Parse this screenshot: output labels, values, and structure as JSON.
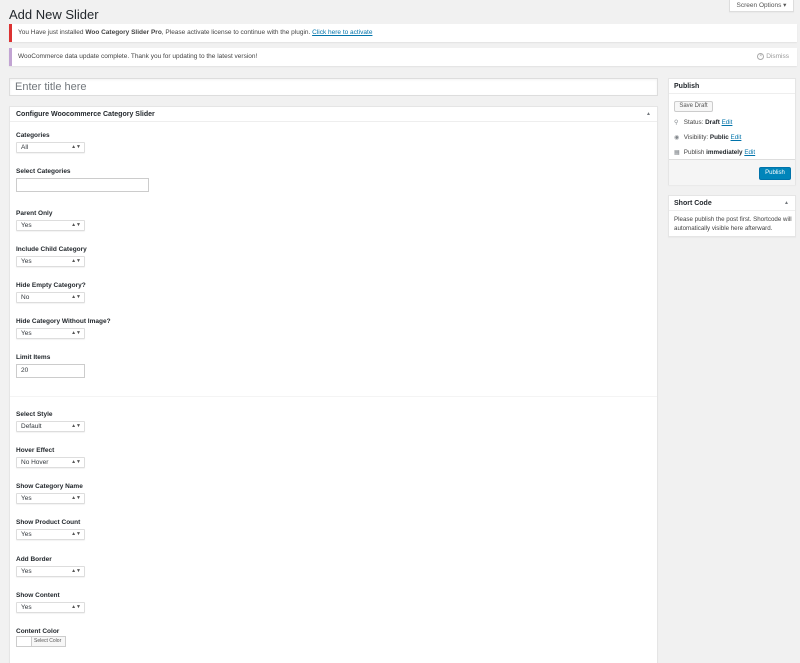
{
  "page": {
    "title": "Add New Slider"
  },
  "screen_options": {
    "label": "Screen Options",
    "icon": "caret-down-icon"
  },
  "notices": {
    "license": {
      "before": "You Have just installed ",
      "product": "Woo Category Slider Pro",
      "after": ", Please activate license to continue with the plugin. ",
      "link": "Click here to activate"
    },
    "woocommerce": {
      "text": "WooCommerce data update complete. Thank you for updating to the latest version!",
      "dismiss": "Dismiss"
    }
  },
  "title_input": {
    "placeholder": "Enter title here",
    "value": ""
  },
  "config_box": {
    "title": "Configure Woocommerce Category Slider",
    "fields": {
      "categories": {
        "label": "Categories",
        "value": "All"
      },
      "select_categories": {
        "label": "Select Categories",
        "value": ""
      },
      "parent_only": {
        "label": "Parent Only",
        "value": "Yes"
      },
      "include_child": {
        "label": "Include Child Category",
        "value": "Yes"
      },
      "hide_empty": {
        "label": "Hide Empty Category?",
        "value": "No"
      },
      "hide_without_image": {
        "label": "Hide Category Without Image?",
        "value": "Yes"
      },
      "limit_items": {
        "label": "Limit Items",
        "value": "20"
      },
      "select_style": {
        "label": "Select Style",
        "value": "Default"
      },
      "hover_effect": {
        "label": "Hover Effect",
        "value": "No Hover"
      },
      "show_category_name": {
        "label": "Show Category Name",
        "value": "Yes"
      },
      "show_product_count": {
        "label": "Show Product Count",
        "value": "Yes"
      },
      "add_border": {
        "label": "Add Border",
        "value": "Yes"
      },
      "show_content": {
        "label": "Show Content",
        "value": "Yes"
      },
      "content_color": {
        "label": "Content Color",
        "button": "Select Color"
      }
    }
  },
  "publish_box": {
    "title": "Publish",
    "save_draft": "Save Draft",
    "status": {
      "label": "Status:",
      "value": "Draft",
      "edit": "Edit"
    },
    "visibility": {
      "label": "Visibility:",
      "value": "Public",
      "edit": "Edit"
    },
    "schedule": {
      "label": "Publish",
      "value": "immediately",
      "edit": "Edit"
    },
    "publish_button": "Publish"
  },
  "shortcode_box": {
    "title": "Short Code",
    "text": "Please publish the post first. Shortcode will automatically visible here afterward."
  }
}
